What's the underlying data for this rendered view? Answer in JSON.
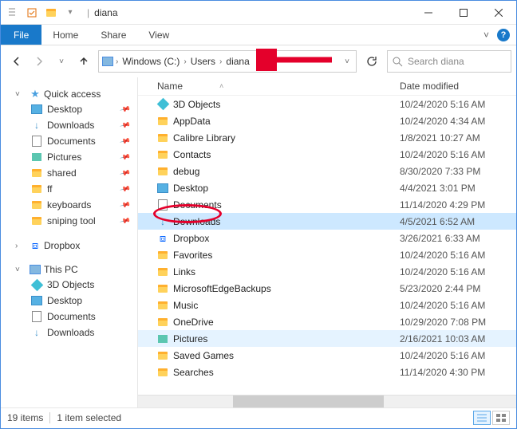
{
  "title_folder": "diana",
  "ribbon": {
    "file": "File",
    "home": "Home",
    "share": "Share",
    "view": "View"
  },
  "breadcrumb": [
    "Windows (C:)",
    "Users",
    "diana"
  ],
  "search_placeholder": "Search diana",
  "sidebar": {
    "quick_access": {
      "label": "Quick access",
      "items": [
        {
          "label": "Desktop",
          "icon": "desktop",
          "pinned": true
        },
        {
          "label": "Downloads",
          "icon": "download",
          "pinned": true
        },
        {
          "label": "Documents",
          "icon": "document",
          "pinned": true
        },
        {
          "label": "Pictures",
          "icon": "picture",
          "pinned": true
        },
        {
          "label": "shared",
          "icon": "folder",
          "pinned": true
        },
        {
          "label": "ff",
          "icon": "folder",
          "pinned": true
        },
        {
          "label": "keyboards",
          "icon": "folder",
          "pinned": true
        },
        {
          "label": "sniping tool",
          "icon": "folder",
          "pinned": true
        }
      ]
    },
    "dropbox": {
      "label": "Dropbox"
    },
    "this_pc": {
      "label": "This PC",
      "items": [
        {
          "label": "3D Objects",
          "icon": "obj3d"
        },
        {
          "label": "Desktop",
          "icon": "desktop"
        },
        {
          "label": "Documents",
          "icon": "document"
        },
        {
          "label": "Downloads",
          "icon": "download"
        }
      ]
    }
  },
  "columns": {
    "name": "Name",
    "date": "Date modified"
  },
  "files": [
    {
      "name": "3D Objects",
      "date": "10/24/2020 5:16 AM",
      "icon": "obj3d"
    },
    {
      "name": "AppData",
      "date": "10/24/2020 4:34 AM",
      "icon": "folder"
    },
    {
      "name": "Calibre Library",
      "date": "1/8/2021 10:27 AM",
      "icon": "folder"
    },
    {
      "name": "Contacts",
      "date": "10/24/2020 5:16 AM",
      "icon": "folder"
    },
    {
      "name": "debug",
      "date": "8/30/2020 7:33 PM",
      "icon": "folder"
    },
    {
      "name": "Desktop",
      "date": "4/4/2021 3:01 PM",
      "icon": "desktop"
    },
    {
      "name": "Documents",
      "date": "11/14/2020 4:29 PM",
      "icon": "document"
    },
    {
      "name": "Downloads",
      "date": "4/5/2021 6:52 AM",
      "icon": "download",
      "selected": true
    },
    {
      "name": "Dropbox",
      "date": "3/26/2021 6:33 AM",
      "icon": "dropbox"
    },
    {
      "name": "Favorites",
      "date": "10/24/2020 5:16 AM",
      "icon": "folder"
    },
    {
      "name": "Links",
      "date": "10/24/2020 5:16 AM",
      "icon": "folder"
    },
    {
      "name": "MicrosoftEdgeBackups",
      "date": "5/23/2020 2:44 PM",
      "icon": "folder"
    },
    {
      "name": "Music",
      "date": "10/24/2020 5:16 AM",
      "icon": "folder"
    },
    {
      "name": "OneDrive",
      "date": "10/29/2020 7:08 PM",
      "icon": "folder"
    },
    {
      "name": "Pictures",
      "date": "2/16/2021 10:03 AM",
      "icon": "picture",
      "highlighted": true
    },
    {
      "name": "Saved Games",
      "date": "10/24/2020 5:16 AM",
      "icon": "folder"
    },
    {
      "name": "Searches",
      "date": "11/14/2020 4:30 PM",
      "icon": "folder"
    }
  ],
  "status": {
    "count": "19 items",
    "selection": "1 item selected"
  }
}
